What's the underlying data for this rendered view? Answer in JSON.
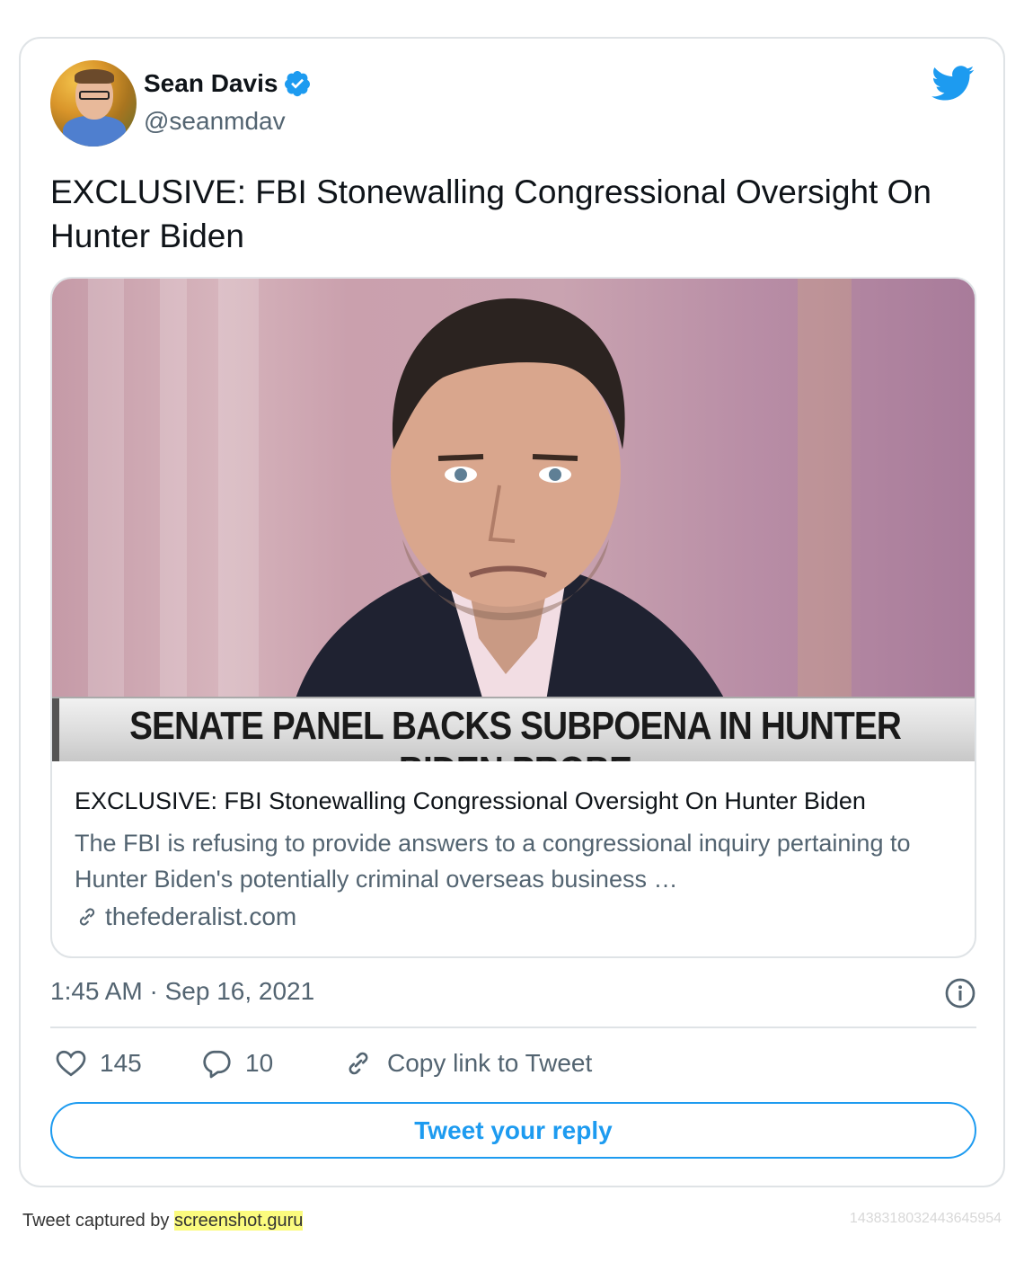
{
  "author": {
    "name": "Sean Davis",
    "handle": "@seanmdav",
    "verified_icon": "verified-badge-icon",
    "avatar_icon": "avatar"
  },
  "tweet": {
    "text": "EXCLUSIVE: FBI Stonewalling Congressional Oversight On Hunter Biden",
    "timestamp": "1:45 AM · Sep 16, 2021"
  },
  "link_card": {
    "image_caption": "SENATE PANEL BACKS SUBPOENA IN HUNTER BIDEN PROBE",
    "title": "EXCLUSIVE: FBI Stonewalling Congressional Oversight On Hunter Biden",
    "description": "The FBI is refusing to provide answers to a congressional inquiry pertaining to Hunter Biden's potentially criminal overseas business …",
    "domain": "thefederalist.com"
  },
  "actions": {
    "likes": "145",
    "replies": "10",
    "copy_link": "Copy link to Tweet",
    "reply_button": "Tweet your reply"
  },
  "footer": {
    "captured_by": "Tweet captured by ",
    "site": "screenshot.guru",
    "tweet_id": "1438318032443645954"
  },
  "colors": {
    "accent": "#1d9bf0",
    "text": "#0f1419",
    "secondary_text": "#536471",
    "border": "#dfe3e6",
    "footer_highlight": "#fbfb7e"
  }
}
